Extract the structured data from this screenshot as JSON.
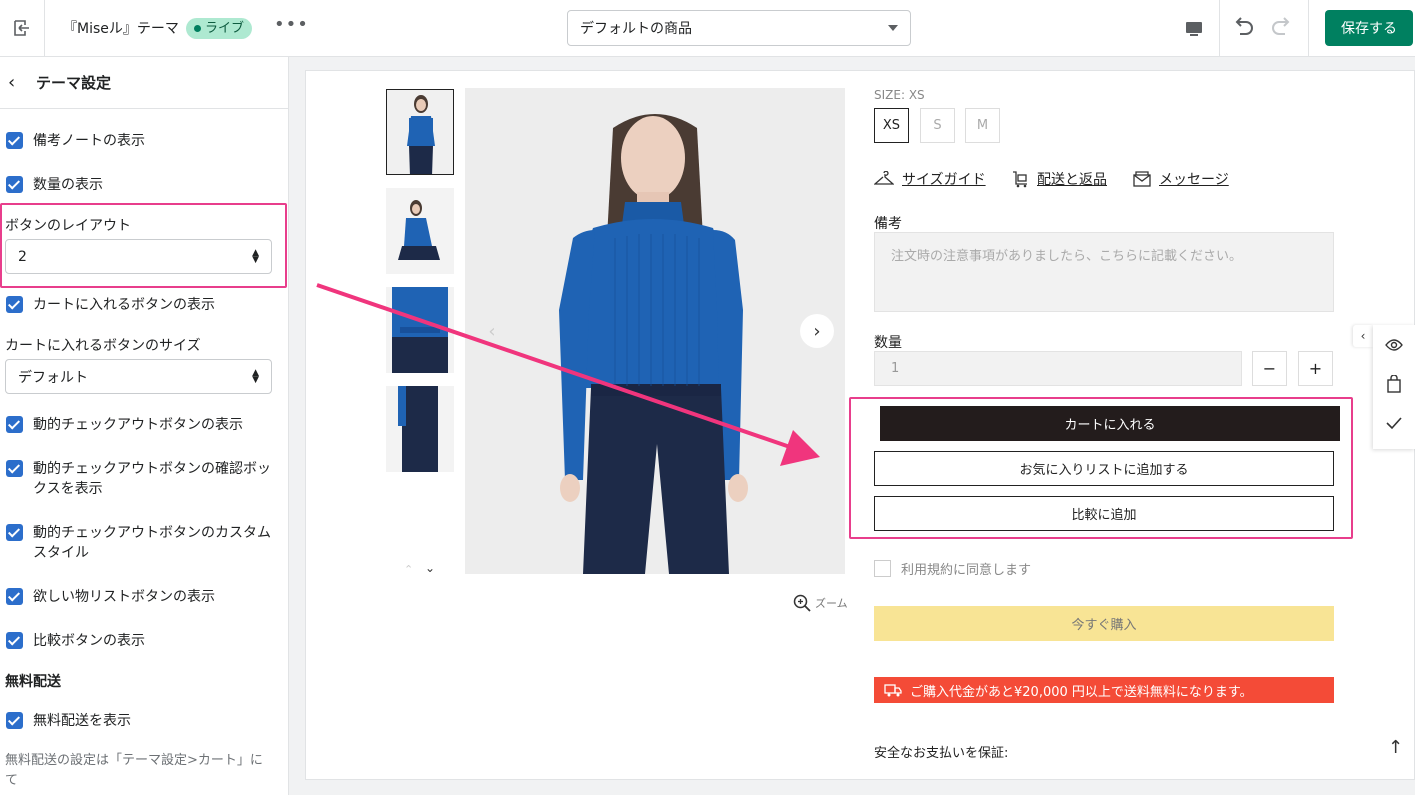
{
  "topbar": {
    "theme_name": "『Miseル』テーマ",
    "status_badge": "ライブ",
    "more_glyph": "•••",
    "template_select_value": "デフォルトの商品",
    "save_label": "保存する"
  },
  "sidebar": {
    "title": "テーマ設定",
    "items": {
      "notes": "備考ノートの表示",
      "quantity": "数量の表示",
      "button_layout_label": "ボタンのレイアウト",
      "button_layout_value": "2",
      "add_to_cart": "カートに入れるボタンの表示",
      "cart_button_size_label": "カートに入れるボタンのサイズ",
      "cart_button_size_value": "デフォルト",
      "dynamic_checkout": "動的チェックアウトボタンの表示",
      "dynamic_checkout_confirm": "動的チェックアウトボタンの確認ボックスを表示",
      "dynamic_checkout_custom": "動的チェックアウトボタンのカスタムスタイル",
      "wishlist": "欲しい物リストボタンの表示",
      "compare": "比較ボタンの表示",
      "free_shipping_heading": "無料配送",
      "free_shipping_show": "無料配送を表示",
      "free_shipping_help": "無料配送の設定は「テーマ設定>カート」にて"
    }
  },
  "product": {
    "size_label": "SIZE: XS",
    "sizes": [
      "XS",
      "S",
      "M"
    ],
    "selected_size": "XS",
    "links": {
      "size_guide": "サイズガイド",
      "shipping": "配送と返品",
      "message": "メッセージ"
    },
    "note_label": "備考",
    "note_placeholder": "注文時の注意事項がありましたら、こちらに記載ください。",
    "qty_label": "数量",
    "qty_value": "1",
    "qty_minus": "−",
    "qty_plus": "+",
    "add_to_cart": "カートに入れる",
    "add_to_wishlist": "お気に入りリストに追加する",
    "add_to_compare": "比較に追加",
    "terms": "利用規約に同意します",
    "buy_now": "今すぐ購入",
    "shipping_notice": "ご購入代金があと¥20,000 円以上で送料無料になります。",
    "secure_payment": "安全なお支払いを保証:",
    "zoom_label": "ズーム"
  },
  "colors": {
    "accent": "#008060",
    "highlight": "#e83e8c",
    "checkbox": "#2c6ecb",
    "cart_button": "#231c1c",
    "buy_button": "#f8e495",
    "ship_bar": "#f44b37",
    "sweater": "#1f63b4"
  }
}
